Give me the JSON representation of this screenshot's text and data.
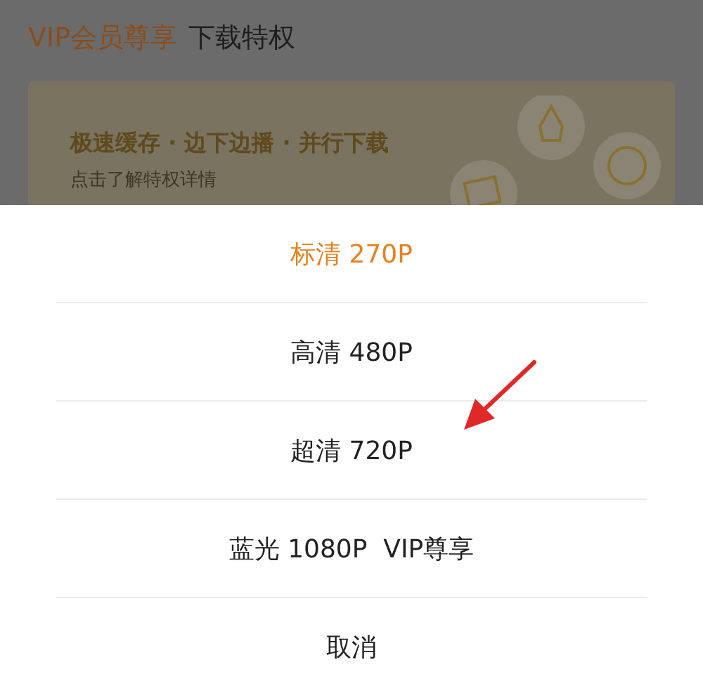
{
  "header": {
    "highlight": "VIP会员尊享",
    "title": "下载特权"
  },
  "banner": {
    "headline": "极速缓存 · 边下边播 · 并行下载",
    "subtitle": "点击了解特权详情"
  },
  "quality_options": [
    {
      "label": "标清 270P",
      "selected": true
    },
    {
      "label": "高清 480P",
      "selected": false
    },
    {
      "label": "超清 720P",
      "selected": false
    },
    {
      "label": "蓝光 1080P  VIP尊享",
      "selected": false
    }
  ],
  "cancel": "取消",
  "annotation": {
    "kind": "arrow"
  }
}
